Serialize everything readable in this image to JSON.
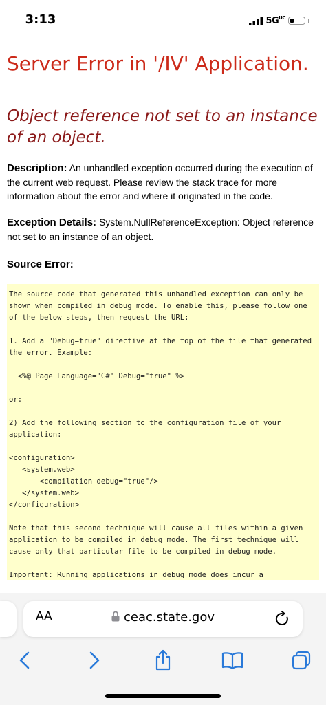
{
  "status_bar": {
    "time": "3:13",
    "network": "5G",
    "network_superscript": "UC"
  },
  "page": {
    "title": "Server Error in '/IV' Application.",
    "message": "Object reference not set to an instance of an object.",
    "description_label": "Description:",
    "description_text": "An unhandled exception occurred during the execution of the current web request. Please review the stack trace for more information about the error and where it originated in the code.",
    "exception_label": "Exception Details:",
    "exception_text": "System.NullReferenceException: Object reference not set to an instance of an object.",
    "source_error_label": "Source Error:",
    "code": {
      "intro": "The source code that generated this unhandled exception can only be shown when compiled in debug mode. To enable this, please follow one of the below steps, then request the URL:",
      "step1": "1. Add a \"Debug=true\" directive at the top of the file that generated the error. Example:",
      "step1_example": "  <%@ Page Language=\"C#\" Debug=\"true\" %>",
      "or": "or:",
      "step2": "2) Add the following section to the configuration file of your application:",
      "config_xml": "<configuration>\n   <system.web>\n       <compilation debug=\"true\"/>\n   </system.web>\n</configuration>",
      "note": "Note that this second technique will cause all files within a given application to be compiled in debug mode. The first technique will cause only that particular file to be compiled in debug mode.",
      "important": "Important: Running applications in debug mode does incur a"
    }
  },
  "browser": {
    "reader_label": "AA",
    "url": "ceac.state.gov",
    "icons": {
      "lock": "lock-icon",
      "reload": "reload-icon",
      "back": "chevron-left-icon",
      "forward": "chevron-right-icon",
      "share": "share-icon",
      "bookmarks": "book-icon",
      "tabs": "tabs-icon"
    },
    "accent_color": "#1a73e8"
  },
  "colors": {
    "title": "#cc2a1a",
    "message": "#8b1a1a",
    "code_background": "#ffffcc"
  }
}
